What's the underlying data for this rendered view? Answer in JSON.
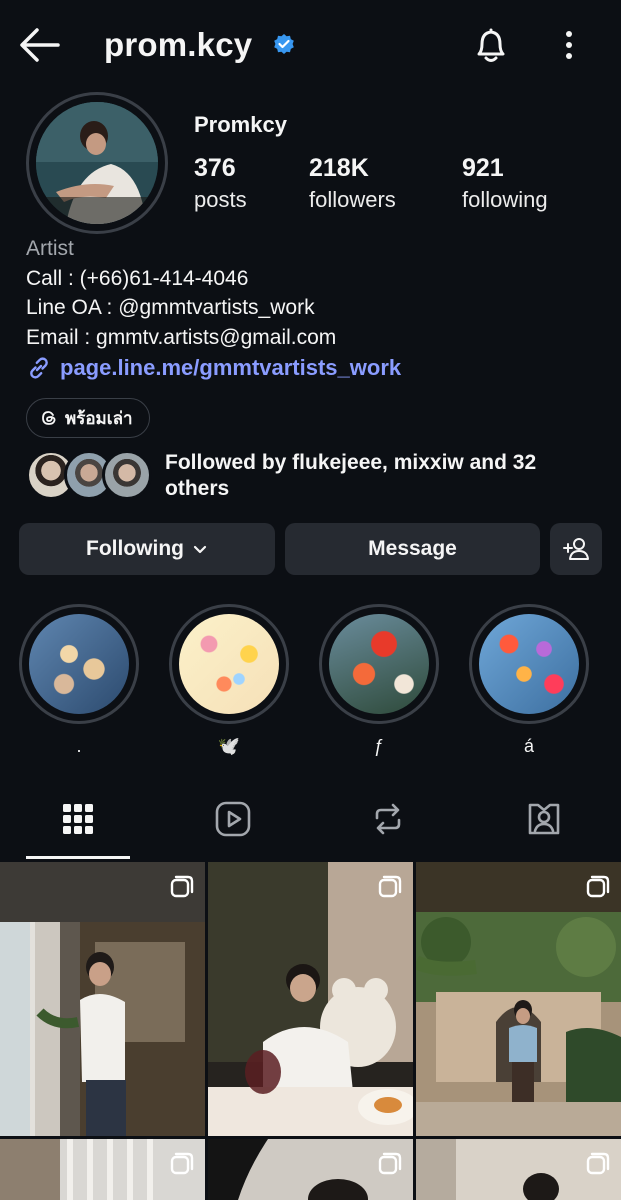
{
  "header": {
    "username": "prom.kcy",
    "verified": true,
    "icons": [
      "back-arrow-icon",
      "verified-badge-icon",
      "bell-icon",
      "more-vertical-icon"
    ]
  },
  "profile": {
    "display_name": "Promkcy",
    "stats": [
      {
        "num": "376",
        "label": "posts"
      },
      {
        "num": "218K",
        "label": "followers"
      },
      {
        "num": "921",
        "label": "following"
      }
    ],
    "bio": {
      "category": "Artist",
      "lines": [
        "Call : (+66)61-414-4046",
        "Line OA : @gmmtvartists_work",
        "Email : gmmtv.artists@gmail.com"
      ]
    },
    "link": "page.line.me/gmmtvartists_work",
    "threads_label": "พร้อมเล่า",
    "followed_by": "Followed by flukejeee, mixxiw and 32 others"
  },
  "buttons": {
    "following": "Following",
    "message": "Message"
  },
  "highlights": [
    {
      "label": "."
    },
    {
      "label": "🕊️"
    },
    {
      "label": "ƒ"
    },
    {
      "label": "á"
    }
  ],
  "tabs": [
    "grid-icon",
    "reels-icon",
    "reposts-icon",
    "tagged-icon"
  ],
  "colors": {
    "background": "#0c0f14",
    "button": "#262a31",
    "link": "#8a9cff",
    "verified": "#3897f0",
    "muted": "#a3a7ad"
  }
}
